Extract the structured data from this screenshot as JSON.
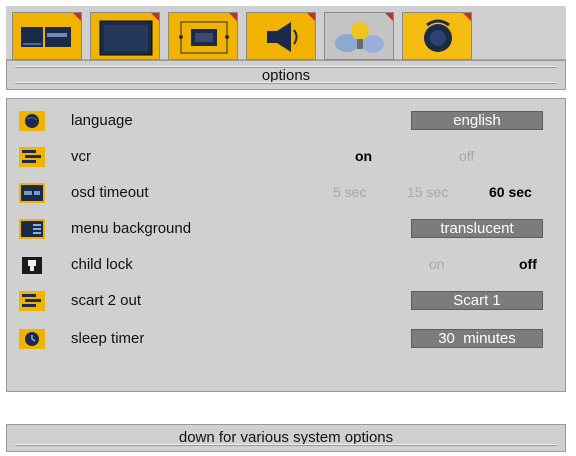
{
  "tabs": [
    {
      "icon": "picture-settings-icon"
    },
    {
      "icon": "screen-icon"
    },
    {
      "icon": "picture-format-icon"
    },
    {
      "icon": "speaker-icon"
    },
    {
      "icon": "feature-icon"
    },
    {
      "icon": "source-icon"
    }
  ],
  "active_tab_index": 5,
  "header": {
    "title": "options"
  },
  "options": {
    "language": {
      "label": "language",
      "value": "english"
    },
    "vcr": {
      "label": "vcr",
      "choices": [
        "on",
        "off"
      ],
      "selected": "on"
    },
    "osd_timeout": {
      "label": "osd timeout",
      "choices": [
        "5 sec",
        "15 sec",
        "60 sec"
      ],
      "selected": "60 sec"
    },
    "menu_background": {
      "label": "menu background",
      "value": "translucent"
    },
    "child_lock": {
      "label": "child lock",
      "choices": [
        "on",
        "off"
      ],
      "selected": "off"
    },
    "scart2_out": {
      "label": "scart 2 out",
      "value": "Scart 1"
    },
    "sleep_timer": {
      "label": "sleep timer",
      "value": "30  minutes"
    }
  },
  "status": {
    "hint": "down for various system options"
  },
  "colors": {
    "accent": "#f0b400",
    "panel": "#d0d0d0",
    "valuebox": "#7c7c7c",
    "marker": "#c03030"
  }
}
